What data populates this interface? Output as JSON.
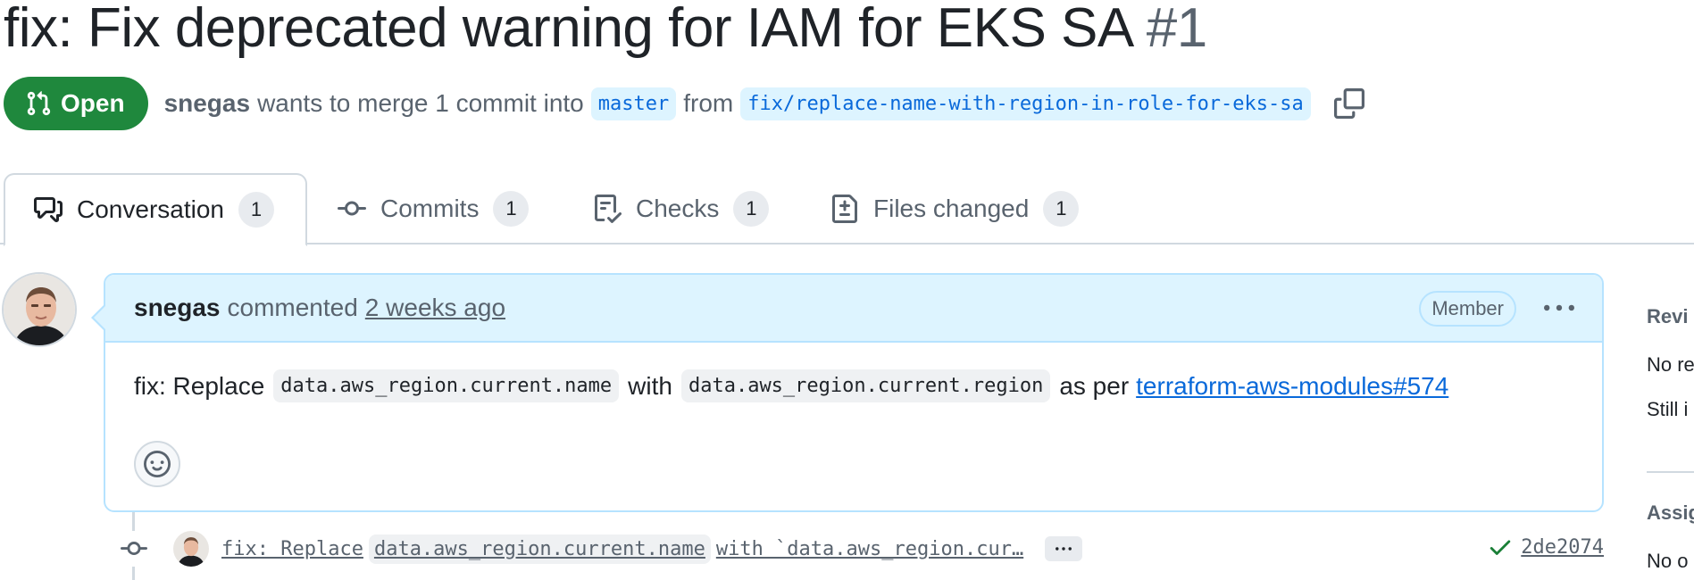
{
  "pr": {
    "title": "fix: Fix deprecated warning for IAM for EKS SA",
    "number": "#1",
    "state": "Open",
    "author": "snegas",
    "merge_text": "wants to merge 1 commit into",
    "base_branch": "master",
    "from_text": "from",
    "head_branch": "fix/replace-name-with-region-in-role-for-eks-sa"
  },
  "tabs": [
    {
      "label": "Conversation",
      "count": "1",
      "icon": "comment-discussion-icon"
    },
    {
      "label": "Commits",
      "count": "1",
      "icon": "git-commit-icon"
    },
    {
      "label": "Checks",
      "count": "1",
      "icon": "checklist-icon"
    },
    {
      "label": "Files changed",
      "count": "1",
      "icon": "file-diff-icon"
    }
  ],
  "comment": {
    "author": "snegas",
    "action": "commented",
    "time": "2 weeks ago",
    "role": "Member",
    "body_prefix": "fix: Replace",
    "code1": "data.aws_region.current.name",
    "body_mid": "with",
    "code2": "data.aws_region.current.region",
    "body_suffix": "as per",
    "link": "terraform-aws-modules#574"
  },
  "commit": {
    "msg_prefix": "fix: Replace",
    "msg_code": "data.aws_region.current.name",
    "msg_suffix": "with `data.aws_region.cur…",
    "sha": "2de2074",
    "status_color": "#1a7f37"
  },
  "sidebar": {
    "reviewers_heading": "Revi",
    "reviewers_line1": "No re",
    "reviewers_line2": "Still i",
    "assignees_heading": "Assig",
    "assignees_line1": "No o"
  },
  "colors": {
    "open_green": "#1f883d",
    "link_blue": "#0969da",
    "header_blue": "#ddf4ff"
  }
}
